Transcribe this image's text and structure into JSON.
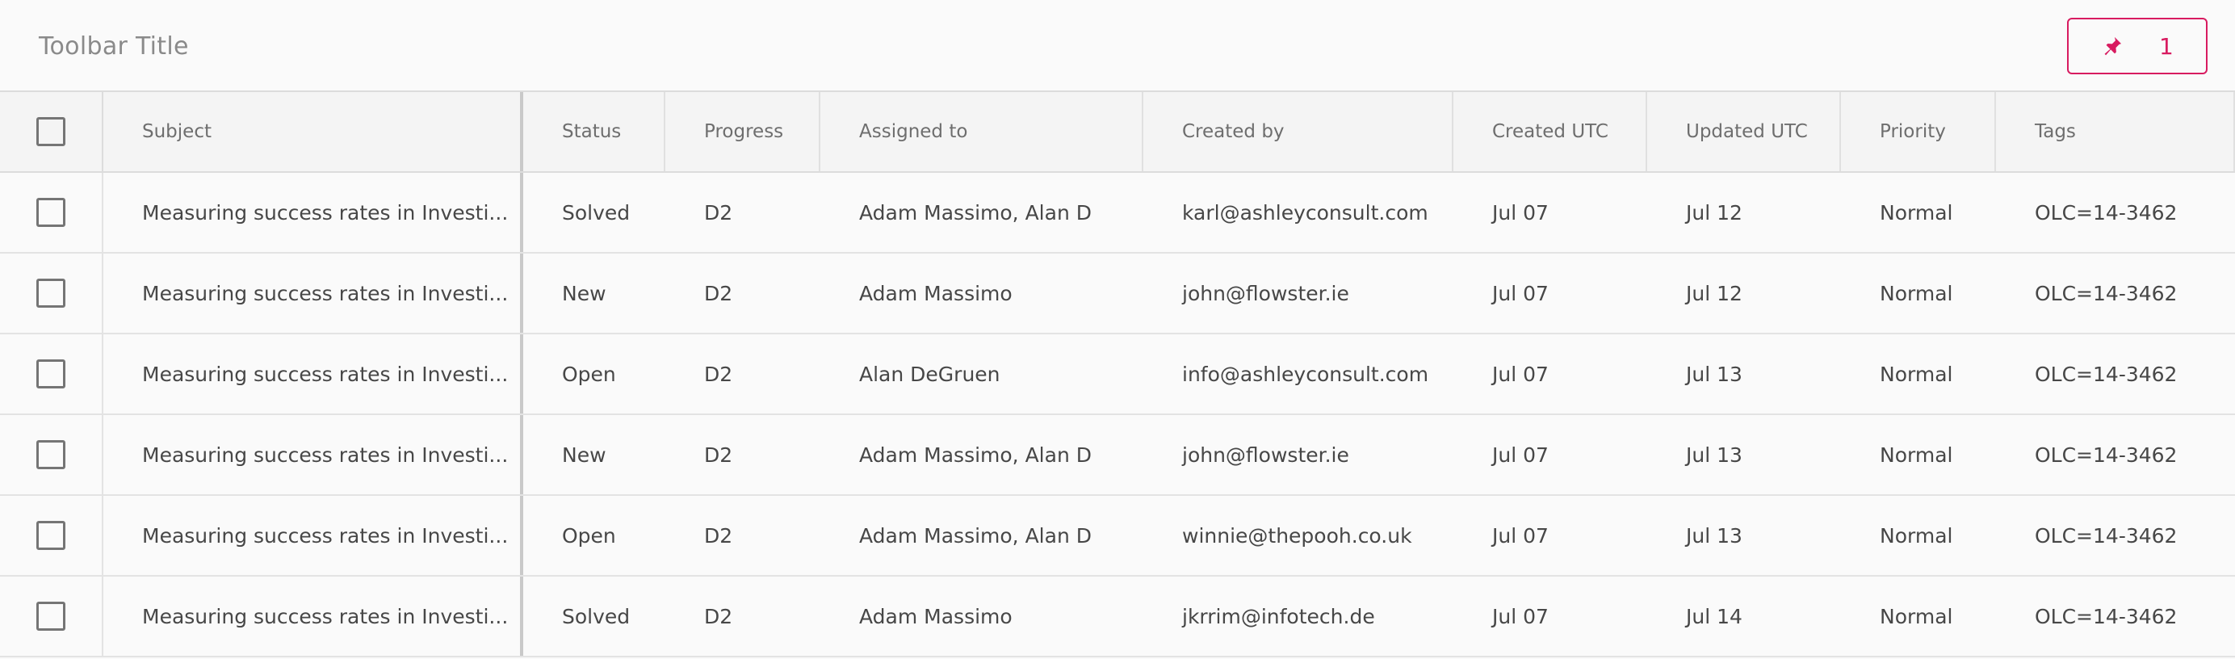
{
  "toolbar": {
    "title": "Toolbar Title",
    "pin_button": {
      "icon": "pin-icon",
      "count": "1",
      "accent": "#d81b60"
    }
  },
  "table": {
    "columns": [
      "Subject",
      "Status",
      "Progress",
      "Assigned to",
      "Created by",
      "Created UTC",
      "Updated UTC",
      "Priority",
      "Tags"
    ],
    "rows": [
      {
        "subject": "Measuring success rates in Investi...",
        "status": "Solved",
        "progress": "D2",
        "assigned_to": "Adam Massimo, Alan D",
        "created_by": "karl@ashleyconsult.com",
        "created_utc": "Jul 07",
        "updated_utc": "Jul 12",
        "priority": "Normal",
        "tags": "OLC=14-3462"
      },
      {
        "subject": "Measuring success rates in Investi...",
        "status": "New",
        "progress": "D2",
        "assigned_to": "Adam Massimo",
        "created_by": "john@flowster.ie",
        "created_utc": "Jul 07",
        "updated_utc": "Jul 12",
        "priority": "Normal",
        "tags": "OLC=14-3462"
      },
      {
        "subject": "Measuring success rates in Investi...",
        "status": "Open",
        "progress": "D2",
        "assigned_to": "Alan DeGruen",
        "created_by": "info@ashleyconsult.com",
        "created_utc": "Jul 07",
        "updated_utc": "Jul 13",
        "priority": "Normal",
        "tags": "OLC=14-3462"
      },
      {
        "subject": "Measuring success rates in Investi...",
        "status": "New",
        "progress": "D2",
        "assigned_to": "Adam Massimo, Alan D",
        "created_by": "john@flowster.ie",
        "created_utc": "Jul 07",
        "updated_utc": "Jul 13",
        "priority": "Normal",
        "tags": "OLC=14-3462"
      },
      {
        "subject": "Measuring success rates in Investi...",
        "status": "Open",
        "progress": "D2",
        "assigned_to": "Adam Massimo, Alan D",
        "created_by": "winnie@thepooh.co.uk",
        "created_utc": "Jul 07",
        "updated_utc": "Jul 13",
        "priority": "Normal",
        "tags": "OLC=14-3462"
      },
      {
        "subject": "Measuring success rates in Investi...",
        "status": "Solved",
        "progress": "D2",
        "assigned_to": "Adam Massimo",
        "created_by": "jkrrim@infotech.de",
        "created_utc": "Jul 07",
        "updated_utc": "Jul 14",
        "priority": "Normal",
        "tags": "OLC=14-3462"
      }
    ]
  }
}
